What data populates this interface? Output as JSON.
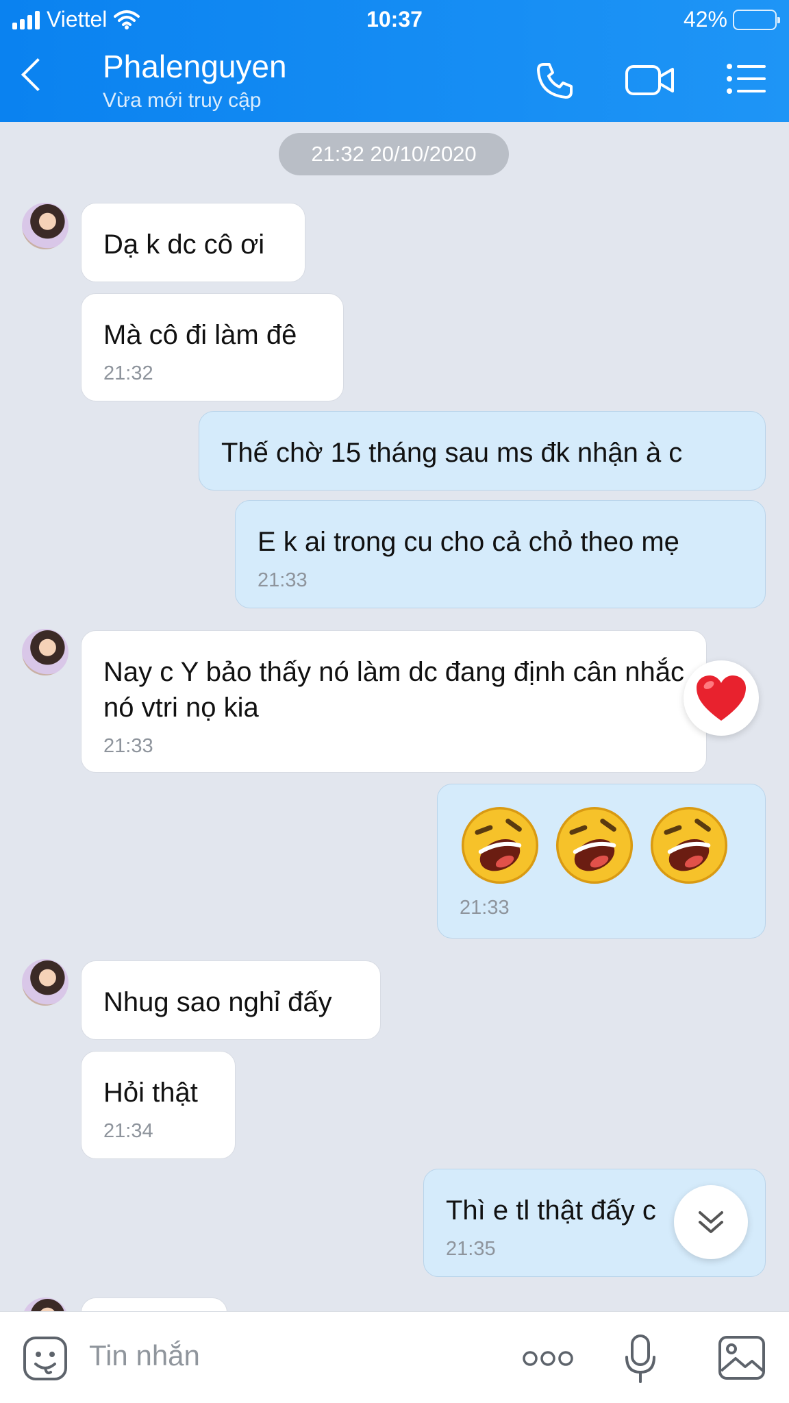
{
  "status_bar": {
    "carrier": "Viettel",
    "time": "10:37",
    "battery_percent": "42%",
    "battery_level": 0.42
  },
  "header": {
    "contact_name": "Phalenguyen",
    "presence": "Vừa mới truy cập",
    "icons": [
      "back-icon",
      "phone-icon",
      "video-call-icon",
      "menu-list-icon"
    ]
  },
  "chat": {
    "date_separator": "21:32 20/10/2020",
    "messages": [
      {
        "side": "in",
        "text": "Dạ k dc cô ơi",
        "time": ""
      },
      {
        "side": "in",
        "text": "Mà cô đi làm đê",
        "time": "21:32"
      },
      {
        "side": "out",
        "text": "Thế chờ 15 tháng sau ms đk nhận à c",
        "time": ""
      },
      {
        "side": "out",
        "text": "E k ai trong cu cho cả chỏ theo mẹ",
        "time": "21:33"
      },
      {
        "side": "in",
        "text": "Nay c Y bảo thấy nó làm dc đang định cân nhắc nó vtri nọ kia",
        "time": "21:33",
        "reaction": "heart"
      },
      {
        "side": "out",
        "text": "",
        "emoji": [
          "laughing-face",
          "laughing-face",
          "laughing-face"
        ],
        "time": "21:33"
      },
      {
        "side": "in",
        "text": "Nhug sao nghỉ đấy",
        "time": ""
      },
      {
        "side": "in",
        "text": "Hỏi thật",
        "time": "21:34"
      },
      {
        "side": "out",
        "text": "Thì e tl thật đấy c",
        "time": "21:35"
      }
    ]
  },
  "composer": {
    "placeholder": "Tin nhắn",
    "icons": [
      "sticker-icon",
      "more-icon",
      "microphone-icon",
      "image-icon"
    ]
  },
  "colors": {
    "header": "#1e95f6",
    "outgoing_bubble": "#d5ebfb",
    "incoming_bubble": "#ffffff",
    "background": "#e2e6ee"
  }
}
